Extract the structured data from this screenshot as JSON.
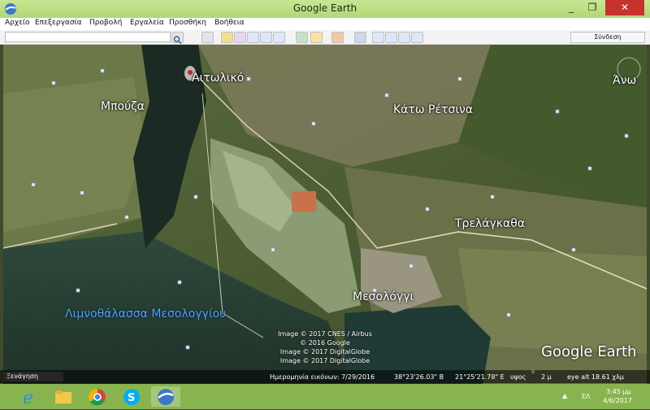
{
  "window": {
    "title": "Google Earth",
    "minimize_glyph": "_",
    "maximize_glyph": "❐",
    "close_glyph": "✕"
  },
  "menu": [
    "Αρχείο",
    "Επεξεργασία",
    "Προβολή",
    "Εργαλεία",
    "Προσθήκη",
    "Βοήθεια"
  ],
  "toolbar": {
    "search_value": "",
    "sign_in": "Σύνδεση"
  },
  "map": {
    "places": [
      {
        "name": "Αιτωλικό"
      },
      {
        "name": "Μπούζα"
      },
      {
        "name": "Κάτω Ρέτσινα"
      },
      {
        "name": "Άνω"
      },
      {
        "name": "Τρελάγκαθα"
      },
      {
        "name": "Μεσολόγγι"
      },
      {
        "name": "Λιμνοθάλασσα Μεσολογγίου"
      }
    ],
    "copyright": [
      "Image © 2017 CNES / Airbus",
      "© 2016 Google",
      "Image © 2017 DigitalGlobe",
      "Image © 2017 DigitalGlobe"
    ],
    "logo": "Google Earth"
  },
  "status": {
    "tour_label": "Ξενάγηση",
    "imagery_date": "Ημερομηνία εικόνων: 7/29/2016",
    "lat": "38°23'26.03\" B",
    "lon": "21°25'21.78\" E",
    "elev_label": "υψος",
    "elev_value": "2 μ",
    "eye_alt": "eye alt  18.61 χλμ"
  },
  "taskbar": {
    "apps": [
      "internet-explorer",
      "file-explorer",
      "chrome",
      "skype",
      "google-earth"
    ],
    "lang": "ΕΛ",
    "time": "3:45 μμ",
    "date": "4/6/2017"
  },
  "colors": {
    "titlebar": "#b3d677",
    "taskbar": "#88b44f",
    "close": "#c7322c",
    "lagoon_label": "#4aa6ff"
  }
}
